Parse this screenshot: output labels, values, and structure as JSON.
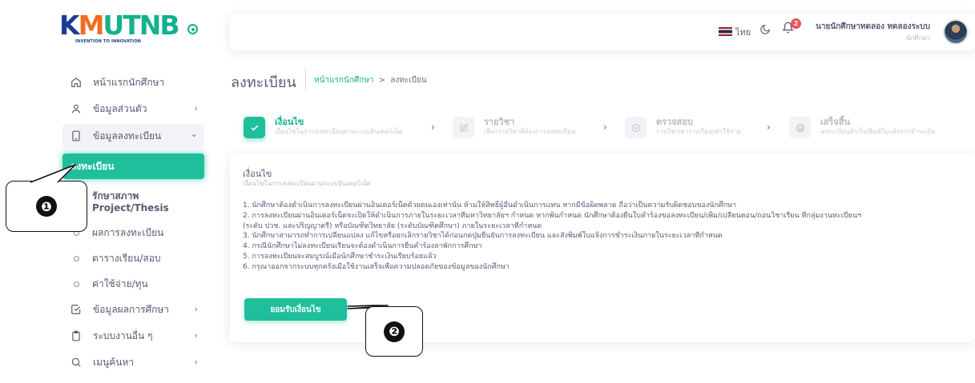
{
  "logo": {
    "text_k": "K",
    "text_x": "M",
    "text_rest": "UTNB",
    "tagline": "INVENTION TO INNOVATION"
  },
  "sidebar": {
    "items": [
      {
        "label": "หน้าแรกนักศึกษา",
        "icon": "home-icon"
      },
      {
        "label": "ข้อมูลส่วนตัว",
        "icon": "user-icon",
        "chevron": "›"
      },
      {
        "label": "ข้อมูลลงทะเบียน",
        "icon": "tablet-icon",
        "chevron": "⌄"
      },
      {
        "label": "ลงทะเบียน"
      },
      {
        "label_line1": "รักษาสภาพ",
        "label_line2": "Project/Thesis"
      },
      {
        "label": "ผลการลงทะเบียน"
      },
      {
        "label": "ตารางเรียน/สอบ"
      },
      {
        "label": "ค่าใช้จ่าย/ทุน"
      },
      {
        "label": "ข้อมูลผลการศึกษา",
        "icon": "check-square-icon",
        "chevron": "›"
      },
      {
        "label": "ระบบงานอื่น ๆ",
        "icon": "clipboard-icon",
        "chevron": "›"
      },
      {
        "label": "เมนูค้นหา",
        "icon": "search-icon",
        "chevron": "›"
      }
    ]
  },
  "header": {
    "language": "ไทย",
    "notification_count": "2",
    "user_name": "นายนักศึกษาทดลอง ทดลองระบบ",
    "user_role": "นักศึกษา"
  },
  "page": {
    "title": "ลงทะเบียน",
    "breadcrumb": {
      "home": "หน้าแรกนักศึกษา",
      "separator": ">",
      "current": "ลงทะเบียน"
    }
  },
  "steps": [
    {
      "title": "เงื่อนไข",
      "subtitle": "เงื่อนไขในการลงทะเบียนผ่านระบบอินเตอร์เน็ต",
      "state": "done",
      "icon": "check-icon"
    },
    {
      "title": "รายวิชา",
      "subtitle": "เลือกรายวิชาที่ต้องการลงทะเบียน",
      "state": "todo",
      "icon": "edit-icon"
    },
    {
      "title": "ตรวจสอบ",
      "subtitle": "รายวิชา/ตารางเรียน/ค่าใช้จ่าย",
      "state": "todo",
      "icon": "check-circle-icon"
    },
    {
      "title": "เสร็จสิ้น",
      "subtitle": "ลงทะเบียนสำเร็จ/พิมพ์ใบแจ้งการชำระเงิน",
      "state": "todo",
      "icon": "printer-icon"
    }
  ],
  "step_arrow": "›",
  "card": {
    "title": "เงื่อนไข",
    "subtitle": "เงื่อนไขในการลงทะเบียนผ่านระบบอินเตอร์เน็ต",
    "terms": [
      "1. นักศึกษาต้องดำเนินการลงทะเบียนผ่านอินเตอร์เน็ตด้วยตนเองเท่านั้น ห้ามให้สิทธิ์ผู้อื่นดำเนินการแทน หากมีข้อผิดพลาด ถือว่าเป็นความรับผิดชอบของนักศึกษา",
      "2. การลงทะเบียนผ่านอินเตอร์เน็ตจะเปิดให้ดำเนินการภายในระยะเวลาที่มหาวิทยาลัยฯ กำหนด หากพ้นกำหนด นักศึกษาต้องยื่นใบคำร้องขอลงทะเบียน/เพิ่ม/เปลี่ยนตอน/ถอนวิชาเรียน ที่กลุ่มงานทะเบียนฯ",
      "(ระดับ ปวช. และปริญญาตรี) หรือบัณฑิตวิทยาลัย (ระดับบัณฑิตศึกษา) ภายในระยะเวลาที่กำหนด",
      "3. นักศึกษาสามารถทำการเปลี่ยนแปลง แก้ไขหรือยกเลิกรายวิชาได้ก่อนกดปุ่มยืนยันการลงทะเบียน และสั่งพิมพ์ใบแจ้งการชำระเงินภายในระยะเวลาที่กำหนด",
      "4. กรณีนักศึกษาไม่ลงทะเบียนเรียนจะต้องดำเนินการยื่นคำร้องลาพักการศึกษา",
      "5. การลงทะเบียนจะสมบูรณ์เมื่อนักศึกษาชำระเงินเรียบร้อยแล้ว",
      "6. กรุณาออกจากระบบทุกครั้งเมื่อใช้งานเสร็จเพื่อความปลอดภัยของข้อมูลของนักศึกษา"
    ],
    "accept_label": "ยอมรับเงื่อนไข"
  },
  "callouts": [
    {
      "number": "❶"
    },
    {
      "number": "❷"
    }
  ],
  "colors": {
    "accent": "#1fbf9b",
    "brand_blue": "#1d3b8f",
    "badge": "#ea5455"
  }
}
